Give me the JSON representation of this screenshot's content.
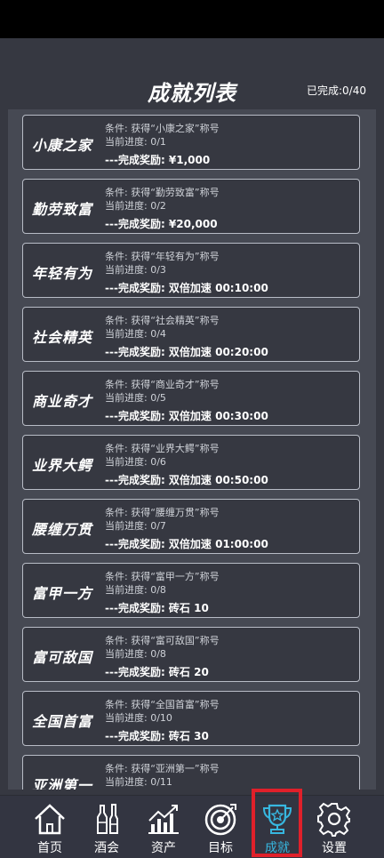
{
  "header": {
    "title": "成就列表",
    "progress": "已完成:0/40"
  },
  "achievements": [
    {
      "name": "小康之家",
      "condition": "条件: 获得“小康之家”称号",
      "progress": "当前进度: 0/1",
      "reward": "---完成奖励: ¥1,000"
    },
    {
      "name": "勤劳致富",
      "condition": "条件: 获得“勤劳致富”称号",
      "progress": "当前进度: 0/2",
      "reward": "---完成奖励: ¥20,000"
    },
    {
      "name": "年轻有为",
      "condition": "条件: 获得“年轻有为”称号",
      "progress": "当前进度: 0/3",
      "reward": "---完成奖励: 双倍加速 00:10:00"
    },
    {
      "name": "社会精英",
      "condition": "条件: 获得“社会精英”称号",
      "progress": "当前进度: 0/4",
      "reward": "---完成奖励: 双倍加速 00:20:00"
    },
    {
      "name": "商业奇才",
      "condition": "条件: 获得“商业奇才”称号",
      "progress": "当前进度: 0/5",
      "reward": "---完成奖励: 双倍加速 00:30:00"
    },
    {
      "name": "业界大鳄",
      "condition": "条件: 获得“业界大鳄”称号",
      "progress": "当前进度: 0/6",
      "reward": "---完成奖励: 双倍加速 00:50:00"
    },
    {
      "name": "腰缠万贯",
      "condition": "条件: 获得“腰缠万贯”称号",
      "progress": "当前进度: 0/7",
      "reward": "---完成奖励: 双倍加速 01:00:00"
    },
    {
      "name": "富甲一方",
      "condition": "条件: 获得“富甲一方”称号",
      "progress": "当前进度: 0/8",
      "reward": "---完成奖励: 砖石 10"
    },
    {
      "name": "富可敌国",
      "condition": "条件: 获得“富可敌国”称号",
      "progress": "当前进度: 0/8",
      "reward": "---完成奖励: 砖石 20"
    },
    {
      "name": "全国首富",
      "condition": "条件: 获得“全国首富”称号",
      "progress": "当前进度: 0/10",
      "reward": "---完成奖励: 砖石 30"
    },
    {
      "name": "亚洲第一",
      "condition": "条件: 获得“亚洲第一”称号",
      "progress": "当前进度: 0/11",
      "reward": ""
    }
  ],
  "tabbar": {
    "items": [
      {
        "label": "首页",
        "icon": "home-icon"
      },
      {
        "label": "酒会",
        "icon": "bottles-icon"
      },
      {
        "label": "资产",
        "icon": "chart-icon"
      },
      {
        "label": "目标",
        "icon": "target-icon"
      },
      {
        "label": "成就",
        "icon": "trophy-icon"
      },
      {
        "label": "设置",
        "icon": "gear-icon"
      }
    ],
    "active_index": 4
  },
  "colors": {
    "background": "#363841",
    "panel": "#464953",
    "accent": "#37b7e0",
    "highlight_frame": "#e0202a"
  }
}
